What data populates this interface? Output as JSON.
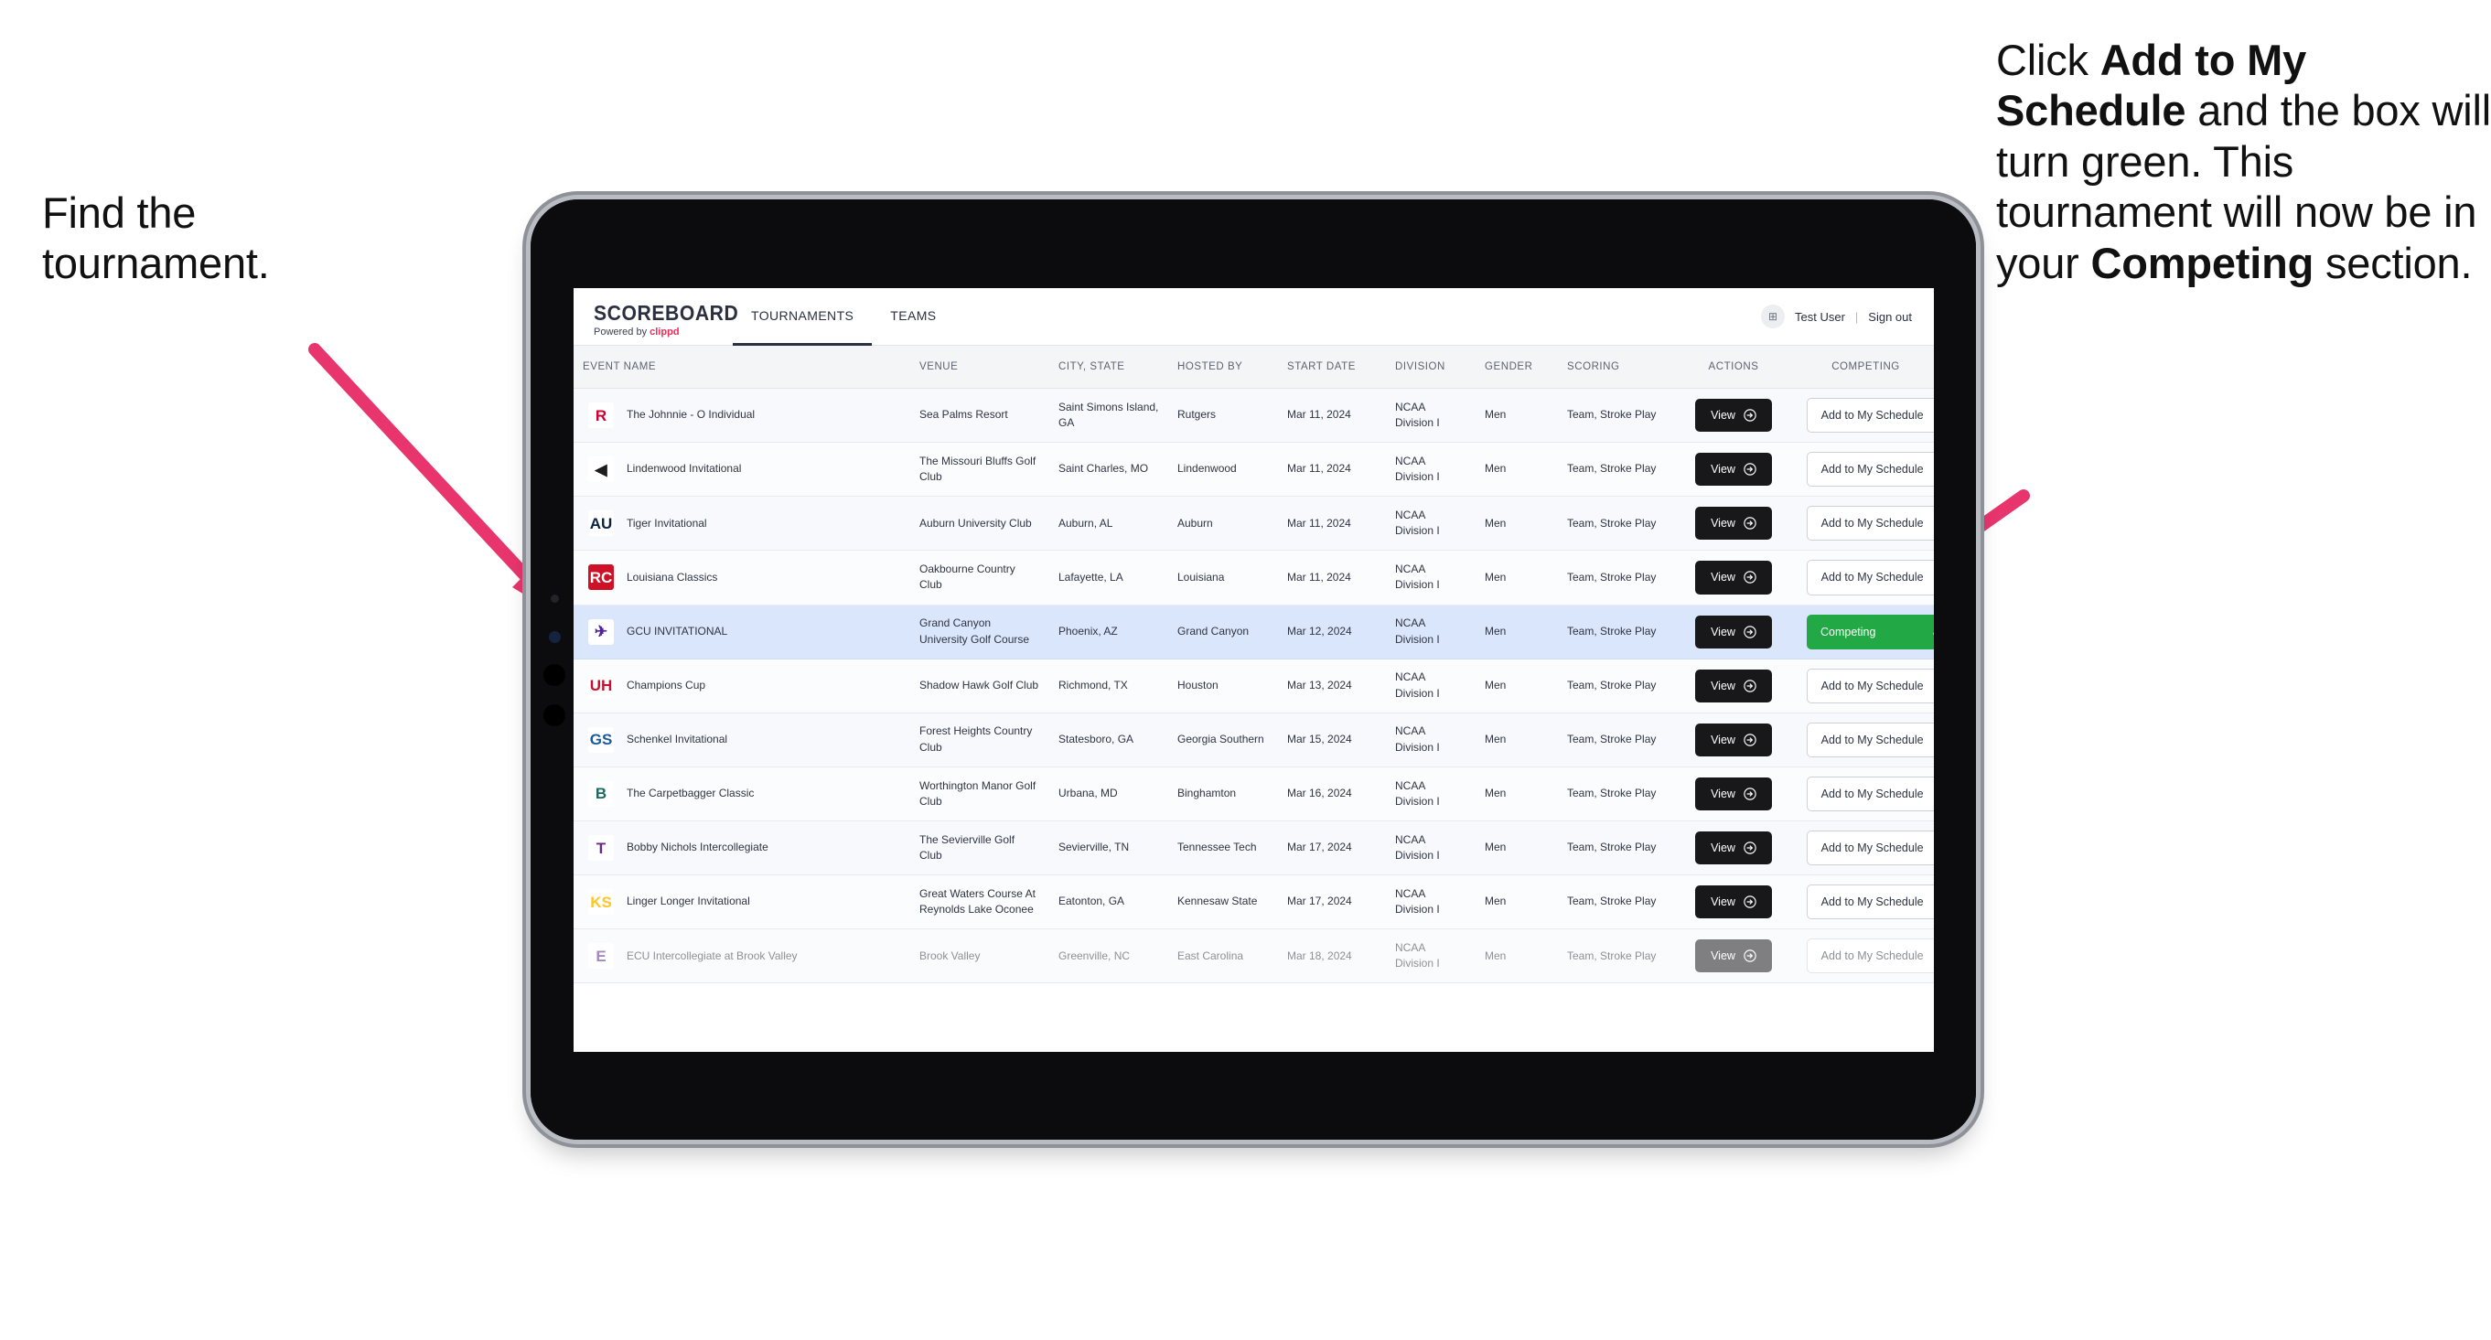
{
  "annotations": {
    "left": {
      "name": "find-the-tournament",
      "line1": "Find the",
      "line2": "tournament."
    },
    "right": {
      "name": "add-to-my-schedule-callout",
      "part1": "Click ",
      "bold1": "Add to My Schedule",
      "part2": " and the box will turn green. This tournament will now be in your ",
      "bold2": "Competing",
      "part3": " section."
    },
    "arrow_color": "#e8356d"
  },
  "navbar": {
    "brand_title": "SCOREBOARD",
    "brand_sub_prefix": "Powered by ",
    "brand_sub_name": "clippd",
    "tabs": [
      {
        "label": "TOURNAMENTS",
        "active": true
      },
      {
        "label": "TEAMS",
        "active": false
      }
    ],
    "avatar_glyph": "⊞",
    "user_name": "Test User",
    "separator": "|",
    "sign_out": "Sign out"
  },
  "table": {
    "columns": [
      "EVENT NAME",
      "VENUE",
      "CITY, STATE",
      "HOSTED BY",
      "START DATE",
      "DIVISION",
      "GENDER",
      "SCORING",
      "ACTIONS",
      "COMPETING"
    ],
    "view_label": "View",
    "add_label": "Add to My Schedule",
    "add_glyph": "+",
    "competing_label": "Competing",
    "competing_glyph": "✓",
    "rows": [
      {
        "logo_text": "R",
        "logo_bg": "#ffffff",
        "logo_fg": "#cc0033",
        "event": "The Johnnie - O Individual",
        "venue": "Sea Palms Resort",
        "city": "Saint Simons Island, GA",
        "hosted_by": "Rutgers",
        "start_date": "Mar 11, 2024",
        "division": "NCAA Division I",
        "gender": "Men",
        "scoring": "Team, Stroke Play",
        "competing": false
      },
      {
        "logo_text": "◀",
        "logo_bg": "#ffffff",
        "logo_fg": "#1c1c1c",
        "event": "Lindenwood Invitational",
        "venue": "The Missouri Bluffs Golf Club",
        "city": "Saint Charles, MO",
        "hosted_by": "Lindenwood",
        "start_date": "Mar 11, 2024",
        "division": "NCAA Division I",
        "gender": "Men",
        "scoring": "Team, Stroke Play",
        "competing": false
      },
      {
        "logo_text": "AU",
        "logo_bg": "#ffffff",
        "logo_fg": "#0c2340",
        "event": "Tiger Invitational",
        "venue": "Auburn University Club",
        "city": "Auburn, AL",
        "hosted_by": "Auburn",
        "start_date": "Mar 11, 2024",
        "division": "NCAA Division I",
        "gender": "Men",
        "scoring": "Team, Stroke Play",
        "competing": false
      },
      {
        "logo_text": "RC",
        "logo_bg": "#ce1126",
        "logo_fg": "#ffffff",
        "event": "Louisiana Classics",
        "venue": "Oakbourne Country Club",
        "city": "Lafayette, LA",
        "hosted_by": "Louisiana",
        "start_date": "Mar 11, 2024",
        "division": "NCAA Division I",
        "gender": "Men",
        "scoring": "Team, Stroke Play",
        "competing": false
      },
      {
        "logo_text": "✈",
        "logo_bg": "#ffffff",
        "logo_fg": "#522398",
        "event": "GCU INVITATIONAL",
        "venue": "Grand Canyon University Golf Course",
        "city": "Phoenix, AZ",
        "hosted_by": "Grand Canyon",
        "start_date": "Mar 12, 2024",
        "division": "NCAA Division I",
        "gender": "Men",
        "scoring": "Team, Stroke Play",
        "competing": true,
        "selected": true
      },
      {
        "logo_text": "UH",
        "logo_bg": "#ffffff",
        "logo_fg": "#c8102e",
        "event": "Champions Cup",
        "venue": "Shadow Hawk Golf Club",
        "city": "Richmond, TX",
        "hosted_by": "Houston",
        "start_date": "Mar 13, 2024",
        "division": "NCAA Division I",
        "gender": "Men",
        "scoring": "Team, Stroke Play",
        "competing": false
      },
      {
        "logo_text": "GS",
        "logo_bg": "#ffffff",
        "logo_fg": "#1c5b9b",
        "event": "Schenkel Invitational",
        "venue": "Forest Heights Country Club",
        "city": "Statesboro, GA",
        "hosted_by": "Georgia Southern",
        "start_date": "Mar 15, 2024",
        "division": "NCAA Division I",
        "gender": "Men",
        "scoring": "Team, Stroke Play",
        "competing": false
      },
      {
        "logo_text": "B",
        "logo_bg": "#ffffff",
        "logo_fg": "#1b6a5f",
        "event": "The Carpetbagger Classic",
        "venue": "Worthington Manor Golf Club",
        "city": "Urbana, MD",
        "hosted_by": "Binghamton",
        "start_date": "Mar 16, 2024",
        "division": "NCAA Division I",
        "gender": "Men",
        "scoring": "Team, Stroke Play",
        "competing": false
      },
      {
        "logo_text": "T",
        "logo_bg": "#ffffff",
        "logo_fg": "#6a2a82",
        "event": "Bobby Nichols Intercollegiate",
        "venue": "The Sevierville Golf Club",
        "city": "Sevierville, TN",
        "hosted_by": "Tennessee Tech",
        "start_date": "Mar 17, 2024",
        "division": "NCAA Division I",
        "gender": "Men",
        "scoring": "Team, Stroke Play",
        "competing": false
      },
      {
        "logo_text": "KS",
        "logo_bg": "#ffffff",
        "logo_fg": "#ffc629",
        "event": "Linger Longer Invitational",
        "venue": "Great Waters Course At Reynolds Lake Oconee",
        "city": "Eatonton, GA",
        "hosted_by": "Kennesaw State",
        "start_date": "Mar 17, 2024",
        "division": "NCAA Division I",
        "gender": "Men",
        "scoring": "Team, Stroke Play",
        "competing": false
      },
      {
        "logo_text": "E",
        "logo_bg": "#ffffff",
        "logo_fg": "#592a8a",
        "event": "ECU Intercollegiate at Brook Valley",
        "venue": "Brook Valley",
        "city": "Greenville, NC",
        "hosted_by": "East Carolina",
        "start_date": "Mar 18, 2024",
        "division": "NCAA Division I",
        "gender": "Men",
        "scoring": "Team, Stroke Play",
        "competing": false,
        "cut_off": true
      }
    ]
  }
}
